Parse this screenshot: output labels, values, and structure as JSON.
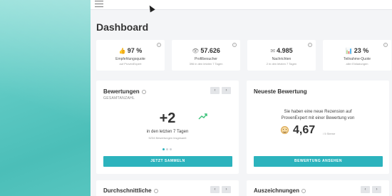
{
  "page": {
    "title": "Dashboard"
  },
  "stats": [
    {
      "icon": "thumbs-up-icon",
      "glyph": "👍",
      "value": "97 %",
      "label": "Empfehlungsquote",
      "sub": "auf ProvenExpert"
    },
    {
      "icon": "eye-icon",
      "glyph": "👁",
      "value": "57.626",
      "label": "Profilbesucher",
      "sub": "396 in den letzten 7 Tagen"
    },
    {
      "icon": "envelope-icon",
      "glyph": "✉",
      "value": "4.985",
      "label": "Nachrichten",
      "sub": "2 in den letzten 7 Tagen"
    },
    {
      "icon": "bar-chart-icon",
      "glyph": "📊",
      "value": "23 %",
      "label": "Teilnahme-Quote",
      "sub": "aller Einladungen"
    }
  ],
  "ratings_card": {
    "title": "Bewertungen",
    "subtitle": "GESAMTANZAHL",
    "big_value": "+2",
    "period": "in den letzten 7 Tagen",
    "total": "5234 Bewertungen insgesamt",
    "button": "JETZT SAMMELN",
    "prev": "‹",
    "next": "›"
  },
  "latest_card": {
    "title": "Neueste Bewertung",
    "message_line1": "Sie haben eine neue Rezension auf",
    "message_line2": "ProvenExpert mit einer Bewertung von",
    "score": "4,67",
    "score_suffix": "/ 5 Sterne",
    "button": "BEWERTUNG ANSEHEN"
  },
  "average_card": {
    "title": "Durchschnittliche",
    "prev": "‹",
    "next": "›"
  },
  "awards_card": {
    "title": "Auszeichnungen",
    "prev": "‹",
    "next": "›"
  }
}
